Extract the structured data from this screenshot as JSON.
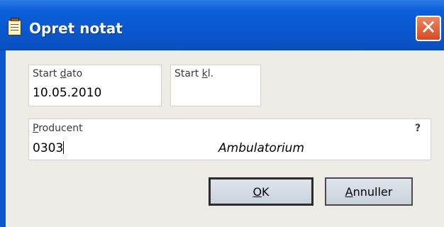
{
  "window": {
    "title": "Opret notat",
    "close_symbol": "✕",
    "title_icon": "note-icon",
    "close_icon": "close-icon"
  },
  "start_date": {
    "label_pre": "Start ",
    "label_accel": "d",
    "label_post": "ato",
    "value": "10.05.2010"
  },
  "start_time": {
    "label_pre": "Start ",
    "label_accel": "k",
    "label_post": "l.",
    "value": ""
  },
  "producer": {
    "label_accel": "P",
    "label_post": "roducent",
    "help": "?",
    "code": "0303",
    "description": "Ambulatorium"
  },
  "buttons": {
    "ok_accel": "O",
    "ok_post": "K",
    "cancel_accel": "A",
    "cancel_post": "nnuller"
  },
  "colors": {
    "titlebar": "#0b58cf",
    "dialog_bg": "#ecebe6",
    "close_button": "#d8491f"
  }
}
